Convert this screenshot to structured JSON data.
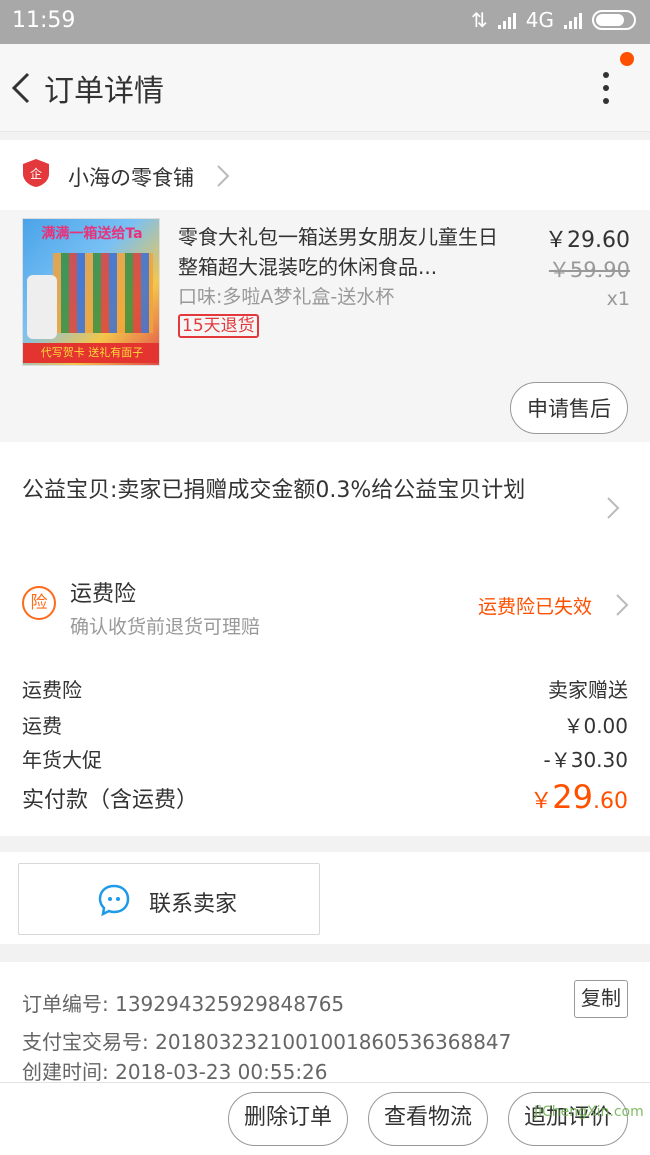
{
  "status_bar": {
    "time": "11:59",
    "network": "4G"
  },
  "header": {
    "title": "订单详情"
  },
  "store": {
    "name": "小海の零食铺"
  },
  "product": {
    "image_text_top": "满满一箱送给Ta",
    "image_text_bottom": "代写贺卡 送礼有面子",
    "title": "零食大礼包一箱送男女朋友儿童生日整箱超大混装吃的休闲食品...",
    "spec": "口味:多啦A梦礼盒-送水杯",
    "tag": "15天退货",
    "price": "￥29.60",
    "original_price": "￥59.90",
    "quantity": "x1",
    "after_sale_label": "申请售后"
  },
  "charity": {
    "text": "公益宝贝:卖家已捐赠成交金额0.3%给公益宝贝计划"
  },
  "insurance": {
    "icon_char": "险",
    "title": "运费险",
    "desc": "确认收货前退货可理赔",
    "status": "运费险已失效"
  },
  "fees": [
    {
      "label": "运费险",
      "value": "卖家赠送"
    },
    {
      "label": "运费",
      "value": "￥0.00"
    },
    {
      "label": "年货大促",
      "value": "-￥30.30"
    }
  ],
  "total": {
    "label": "实付款（含运费）",
    "currency": "￥",
    "integer": "29",
    "decimal": ".60"
  },
  "contact": {
    "label": "联系卖家"
  },
  "order_meta": {
    "order_no": "订单编号: 139294325929848765",
    "copy_label": "复制",
    "alipay_no": "支付宝交易号: 2018032321001001860536368847",
    "created": "创建时间: 2018-03-23 00:55:26"
  },
  "actions": {
    "delete": "删除订单",
    "logistics": "查看物流",
    "review": "追加评价"
  },
  "watermark": "JiChengXin.com",
  "colors": {
    "accent": "#ff5000",
    "status_bar": "#a8a8a8"
  }
}
